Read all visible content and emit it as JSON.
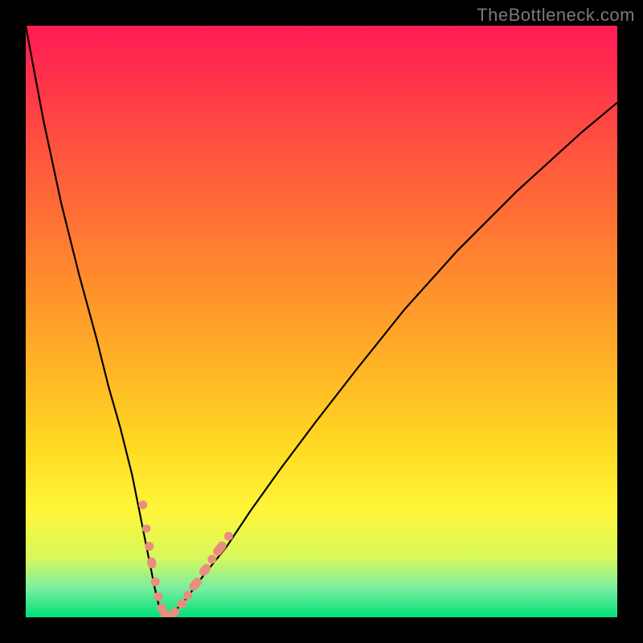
{
  "watermark": "TheBottleneck.com",
  "chart_data": {
    "type": "line",
    "title": "",
    "xlabel": "",
    "ylabel": "",
    "xlim": [
      0,
      100
    ],
    "ylim": [
      0,
      100
    ],
    "grid": false,
    "legend": false,
    "series": [
      {
        "name": "curve",
        "x": [
          0,
          3,
          6,
          9,
          12,
          14,
          16,
          18,
          19,
          20,
          21,
          21.8,
          22.5,
          23.2,
          24,
          25,
          27,
          30,
          34,
          38,
          43,
          49,
          56,
          64,
          73,
          83,
          94,
          100
        ],
        "y": [
          100,
          84,
          70,
          58,
          47,
          39,
          32,
          24,
          19,
          14,
          9,
          5,
          2,
          0.5,
          0,
          0.8,
          3,
          7,
          12,
          18,
          25,
          33,
          42,
          52,
          62,
          72,
          82,
          87
        ]
      }
    ],
    "markers": {
      "color": "#e98e7e",
      "points": [
        {
          "x": 19.8,
          "y": 19.0,
          "shape": "circle"
        },
        {
          "x": 20.4,
          "y": 15.0,
          "shape": "pill",
          "angle": 78,
          "len": 10
        },
        {
          "x": 20.9,
          "y": 12.0,
          "shape": "circle"
        },
        {
          "x": 21.3,
          "y": 9.2,
          "shape": "pill",
          "angle": 78,
          "len": 14
        },
        {
          "x": 21.9,
          "y": 6.0,
          "shape": "circle"
        },
        {
          "x": 22.4,
          "y": 3.5,
          "shape": "circle"
        },
        {
          "x": 23.0,
          "y": 1.5,
          "shape": "pill",
          "angle": 55,
          "len": 12
        },
        {
          "x": 24.0,
          "y": 0.3,
          "shape": "pill",
          "angle": 10,
          "len": 18
        },
        {
          "x": 25.2,
          "y": 0.9,
          "shape": "circle"
        },
        {
          "x": 26.4,
          "y": 2.3,
          "shape": "pill",
          "angle": -48,
          "len": 12
        },
        {
          "x": 27.4,
          "y": 3.7,
          "shape": "circle"
        },
        {
          "x": 28.7,
          "y": 5.6,
          "shape": "pill",
          "angle": -50,
          "len": 18
        },
        {
          "x": 30.3,
          "y": 8.0,
          "shape": "pill",
          "angle": -50,
          "len": 16
        },
        {
          "x": 31.5,
          "y": 9.8,
          "shape": "circle"
        },
        {
          "x": 32.8,
          "y": 11.6,
          "shape": "pill",
          "angle": -52,
          "len": 20
        },
        {
          "x": 34.3,
          "y": 13.7,
          "shape": "circle"
        }
      ]
    },
    "background_gradient": {
      "stops": [
        {
          "pos": 0.0,
          "color": "#ff1b54"
        },
        {
          "pos": 0.5,
          "color": "#ffad26"
        },
        {
          "pos": 0.82,
          "color": "#fff63a"
        },
        {
          "pos": 1.0,
          "color": "#00e07b"
        }
      ]
    }
  }
}
